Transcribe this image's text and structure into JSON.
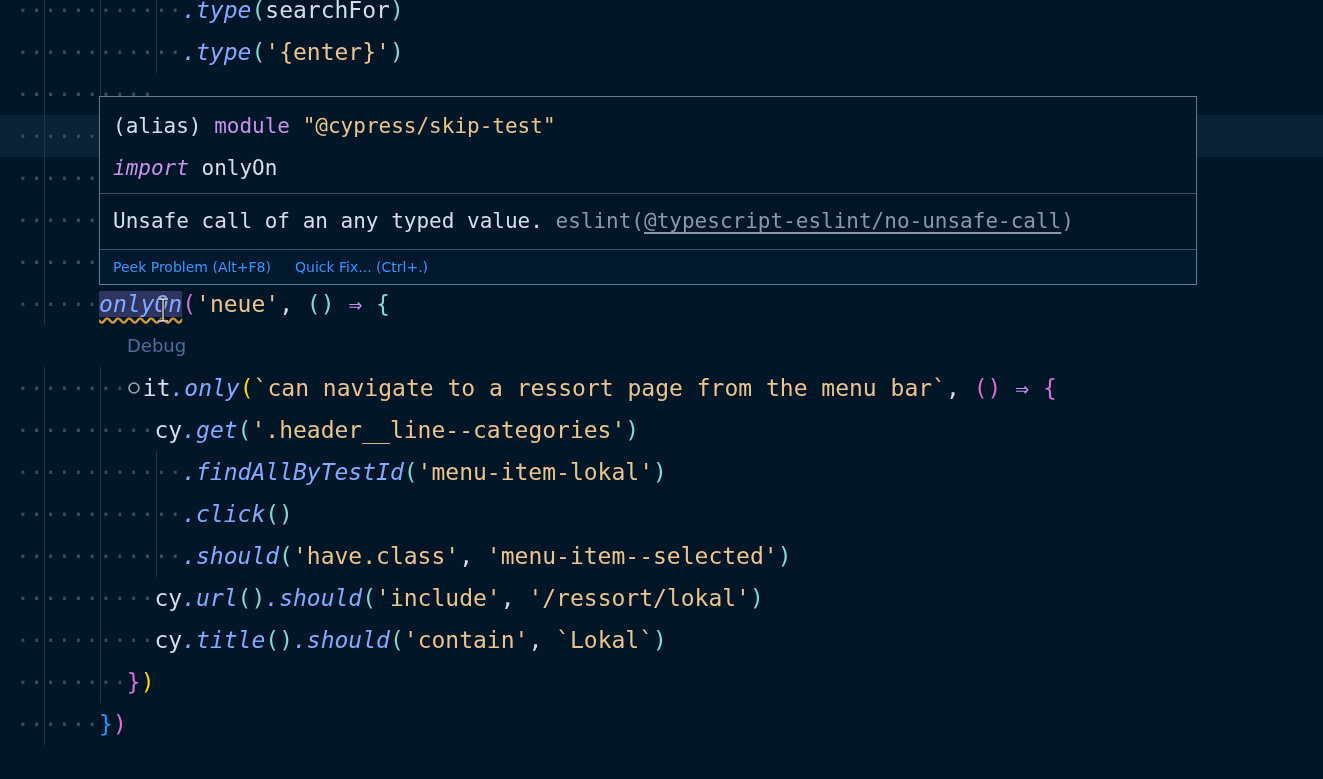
{
  "editor": {
    "lines": [
      {
        "kind": "code",
        "tokens": [
          {
            "kind": "ws",
            "text": "············"
          },
          {
            "kind": "method",
            "text": ".type"
          },
          {
            "kind": "punct",
            "text": "("
          },
          {
            "kind": "plain",
            "text": "searchFor"
          },
          {
            "kind": "punct",
            "text": ")"
          }
        ]
      },
      {
        "kind": "code",
        "tokens": [
          {
            "kind": "ws",
            "text": "············"
          },
          {
            "kind": "method",
            "text": ".type"
          },
          {
            "kind": "punct",
            "text": "("
          },
          {
            "kind": "string",
            "text": "'{enter}'"
          },
          {
            "kind": "punct",
            "text": ")"
          }
        ]
      },
      {
        "kind": "code",
        "tokens": [
          {
            "kind": "ws",
            "text": "··········"
          }
        ]
      },
      {
        "kind": "code",
        "current": true,
        "tokens": [
          {
            "kind": "ws",
            "text": "······"
          }
        ]
      },
      {
        "kind": "code",
        "tokens": [
          {
            "kind": "ws",
            "text": "······"
          }
        ]
      },
      {
        "kind": "code",
        "tokens": [
          {
            "kind": "ws",
            "text": "······"
          }
        ]
      },
      {
        "kind": "code",
        "tokens": [
          {
            "kind": "ws",
            "text": "······"
          }
        ]
      },
      {
        "kind": "code",
        "tokens": [
          {
            "kind": "ws",
            "text": "······"
          },
          {
            "kind": "method",
            "text": "onlyOn",
            "hovered": true,
            "problem": true
          },
          {
            "kind": "b2",
            "text": "("
          },
          {
            "kind": "string",
            "text": "'neue'"
          },
          {
            "kind": "plain",
            "text": ", "
          },
          {
            "kind": "punct",
            "text": "()"
          },
          {
            "kind": "keyword",
            "text": " ⇒ "
          },
          {
            "kind": "punct",
            "text": "{"
          }
        ]
      },
      {
        "kind": "codelens",
        "text": "Debug"
      },
      {
        "kind": "code",
        "tokens": [
          {
            "kind": "ws",
            "text": "········"
          },
          {
            "kind": "marker"
          },
          {
            "kind": "plain",
            "text": "it"
          },
          {
            "kind": "method",
            "text": ".only"
          },
          {
            "kind": "b1",
            "text": "("
          },
          {
            "kind": "string",
            "text": "`can navigate to a ressort page from the menu bar`"
          },
          {
            "kind": "plain",
            "text": ", "
          },
          {
            "kind": "b2",
            "text": "()"
          },
          {
            "kind": "keyword",
            "text": " ⇒ "
          },
          {
            "kind": "b2",
            "text": "{"
          }
        ]
      },
      {
        "kind": "code",
        "tokens": [
          {
            "kind": "ws",
            "text": "··········"
          },
          {
            "kind": "plain",
            "text": "cy"
          },
          {
            "kind": "method",
            "text": ".get"
          },
          {
            "kind": "punct",
            "text": "("
          },
          {
            "kind": "string",
            "text": "'.header__line--categories'"
          },
          {
            "kind": "punct",
            "text": ")"
          }
        ]
      },
      {
        "kind": "code",
        "tokens": [
          {
            "kind": "ws",
            "text": "············"
          },
          {
            "kind": "method",
            "text": ".findAllByTestId"
          },
          {
            "kind": "punct",
            "text": "("
          },
          {
            "kind": "string",
            "text": "'menu-item-lokal'"
          },
          {
            "kind": "punct",
            "text": ")"
          }
        ]
      },
      {
        "kind": "code",
        "tokens": [
          {
            "kind": "ws",
            "text": "············"
          },
          {
            "kind": "method",
            "text": ".click"
          },
          {
            "kind": "punct",
            "text": "()"
          }
        ]
      },
      {
        "kind": "code",
        "tokens": [
          {
            "kind": "ws",
            "text": "············"
          },
          {
            "kind": "method",
            "text": ".should"
          },
          {
            "kind": "punct",
            "text": "("
          },
          {
            "kind": "string",
            "text": "'have.class'"
          },
          {
            "kind": "plain",
            "text": ", "
          },
          {
            "kind": "string",
            "text": "'menu-item--selected'"
          },
          {
            "kind": "punct",
            "text": ")"
          }
        ]
      },
      {
        "kind": "code",
        "tokens": [
          {
            "kind": "ws",
            "text": "··········"
          },
          {
            "kind": "plain",
            "text": "cy"
          },
          {
            "kind": "method",
            "text": ".url"
          },
          {
            "kind": "punct",
            "text": "()"
          },
          {
            "kind": "method",
            "text": ".should"
          },
          {
            "kind": "punct",
            "text": "("
          },
          {
            "kind": "string",
            "text": "'include'"
          },
          {
            "kind": "plain",
            "text": ", "
          },
          {
            "kind": "string",
            "text": "'/ressort/lokal'"
          },
          {
            "kind": "punct",
            "text": ")"
          }
        ]
      },
      {
        "kind": "code",
        "tokens": [
          {
            "kind": "ws",
            "text": "··········"
          },
          {
            "kind": "plain",
            "text": "cy"
          },
          {
            "kind": "method",
            "text": ".title"
          },
          {
            "kind": "punct",
            "text": "()"
          },
          {
            "kind": "method",
            "text": ".should"
          },
          {
            "kind": "punct",
            "text": "("
          },
          {
            "kind": "string",
            "text": "'contain'"
          },
          {
            "kind": "plain",
            "text": ", "
          },
          {
            "kind": "string",
            "text": "`Lokal`"
          },
          {
            "kind": "punct",
            "text": ")"
          }
        ]
      },
      {
        "kind": "code",
        "tokens": [
          {
            "kind": "ws",
            "text": "········"
          },
          {
            "kind": "b2",
            "text": "}"
          },
          {
            "kind": "b1",
            "text": ")"
          }
        ]
      },
      {
        "kind": "code",
        "tokens": [
          {
            "kind": "ws",
            "text": "······"
          },
          {
            "kind": "b3",
            "text": "}"
          },
          {
            "kind": "b2",
            "text": ")"
          }
        ]
      }
    ]
  },
  "hover": {
    "signature": [
      [
        {
          "kind": "plain",
          "text": "(alias) "
        },
        {
          "kind": "keyword",
          "text": "module "
        },
        {
          "kind": "string",
          "text": "\"@cypress/skip-test\""
        }
      ],
      [
        {
          "kind": "keyword-italic",
          "text": "import"
        },
        {
          "kind": "plain",
          "text": " onlyOn"
        }
      ]
    ],
    "message": {
      "text": "Unsafe call of an any typed value.",
      "source": "eslint(",
      "rule": "@typescript-eslint/no-unsafe-call",
      "source_end": ")"
    },
    "actions": [
      "Peek Problem (Alt+F8)",
      "Quick Fix... (Ctrl+.)"
    ]
  }
}
